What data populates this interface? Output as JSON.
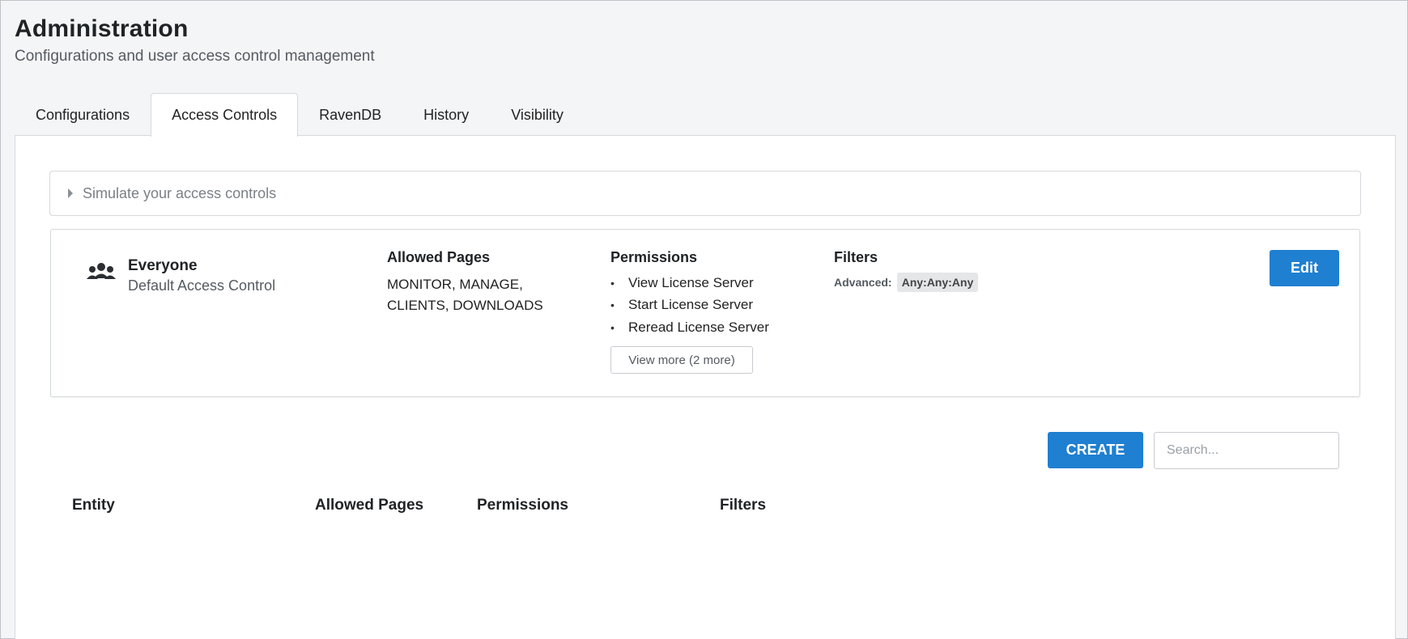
{
  "header": {
    "title": "Administration",
    "subtitle": "Configurations and user access control management"
  },
  "tabs": [
    {
      "label": "Configurations",
      "active": false
    },
    {
      "label": "Access Controls",
      "active": true
    },
    {
      "label": "RavenDB",
      "active": false
    },
    {
      "label": "History",
      "active": false
    },
    {
      "label": "Visibility",
      "active": false
    }
  ],
  "simulate": {
    "label": "Simulate your access controls",
    "icon": "caret-right-icon"
  },
  "access_control": {
    "entity_icon": "users-group-icon",
    "entity_name": "Everyone",
    "entity_description": "Default Access Control",
    "allowed_pages_title": "Allowed Pages",
    "allowed_pages": "MONITOR, MANAGE, CLIENTS, DOWNLOADS",
    "permissions_title": "Permissions",
    "permissions": [
      "View License Server",
      "Start License Server",
      "Reread License Server"
    ],
    "bullet": "•",
    "view_more_label": "View more (2 more)",
    "filters_title": "Filters",
    "filter_key": "Advanced:",
    "filter_value": "Any:Any:Any",
    "edit_label": "Edit"
  },
  "actions": {
    "create_label": "CREATE",
    "search_placeholder": "Search..."
  },
  "table": {
    "columns": [
      "Entity",
      "Allowed Pages",
      "Permissions",
      "Filters"
    ]
  },
  "colors": {
    "primary": "#1f7fd1",
    "background": "#f4f5f7",
    "panel": "#ffffff",
    "border": "#d6d8db"
  }
}
